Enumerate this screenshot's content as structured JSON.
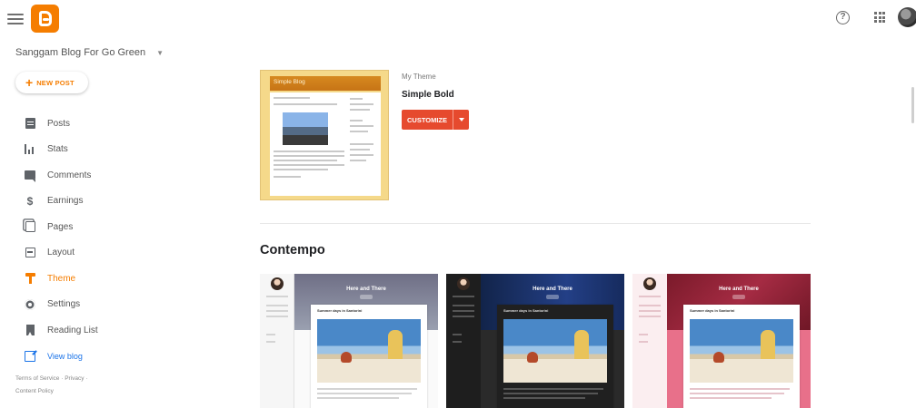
{
  "header": {
    "menu_icon": "hamburger-menu-icon",
    "logo_icon": "blogger-logo-icon",
    "help_icon": "help-circle-icon",
    "apps_icon": "apps-grid-icon",
    "brand_color": "#f57d00"
  },
  "sidebar": {
    "blog_name": "Sanggam Blog For Go Green",
    "new_post_label": "NEW POST",
    "items": [
      {
        "label": "Posts",
        "icon": "posts-icon"
      },
      {
        "label": "Stats",
        "icon": "stats-icon"
      },
      {
        "label": "Comments",
        "icon": "comments-icon"
      },
      {
        "label": "Earnings",
        "icon": "dollar-icon"
      },
      {
        "label": "Pages",
        "icon": "pages-icon"
      },
      {
        "label": "Layout",
        "icon": "layout-icon"
      },
      {
        "label": "Theme",
        "icon": "theme-icon",
        "active": true
      },
      {
        "label": "Settings",
        "icon": "gear-icon"
      },
      {
        "label": "Reading List",
        "icon": "bookmark-icon"
      }
    ],
    "view_blog_label": "View blog",
    "footer": {
      "terms": "Terms of Service",
      "privacy": "Privacy",
      "content_policy": "Content Policy"
    }
  },
  "main": {
    "current_theme": {
      "preview_title": "Simple Blog",
      "section_label": "My Theme",
      "name": "Simple Bold",
      "customize_label": "CUSTOMIZE",
      "accent_color": "#e64a2e"
    },
    "gallery": {
      "title": "Contempo",
      "themes": [
        {
          "hero_title": "Here and There",
          "post_title": "Summer days in Santorini"
        },
        {
          "hero_title": "Here and There",
          "post_title": "Summer days in Santorini"
        },
        {
          "hero_title": "Here and There",
          "post_title": "Summer days in Santorini"
        }
      ]
    }
  }
}
